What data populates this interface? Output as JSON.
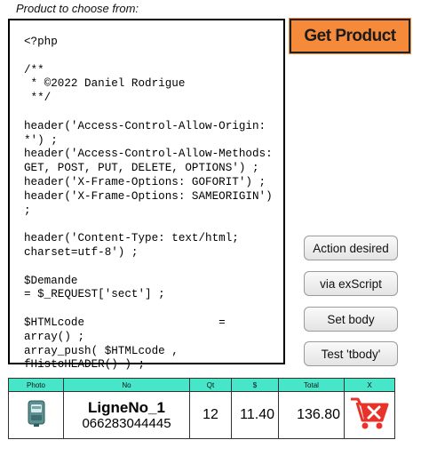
{
  "header": {
    "caption": "Product to choose from:"
  },
  "code": {
    "text": "<?php\n\n/**\n * ©2022 Daniel Rodrigue\n **/\n\nheader('Access-Control-Allow-Origin:\n*') ;\nheader('Access-Control-Allow-Methods:\nGET, POST, PUT, DELETE, OPTIONS') ;\nheader('X-Frame-Options: GOFORIT') ;\nheader('X-Frame-Options: SAMEORIGIN')\n;\n\nheader('Content-Type: text/html;\ncharset=utf-8') ;\n\n$Demande\n= $_REQUEST['sect'] ;\n\n$HTMLcode                    =\narray() ;\narray_push( $HTMLcode ,\nfHistoHEADER() ) ;"
  },
  "buttons": {
    "get_product": "Get Product",
    "action_desired": "Action desired",
    "via_exscript": "via exScript",
    "set_body": "Set body",
    "test_tbody": "Test 'tbody'"
  },
  "table": {
    "headers": [
      "Photo",
      "No",
      "Qt",
      "$",
      "Total",
      "X"
    ],
    "rows": [
      {
        "name": "LigneNo_1",
        "number": "066283044445",
        "qt": "12",
        "price": "11.40",
        "total": "136.80"
      }
    ]
  },
  "colors": {
    "accent": "#f58b3a",
    "table_header": "#48e6c8",
    "cart_icon": "#e8332a"
  },
  "icons": [
    "product-photo-icon",
    "remove-cart-icon"
  ]
}
